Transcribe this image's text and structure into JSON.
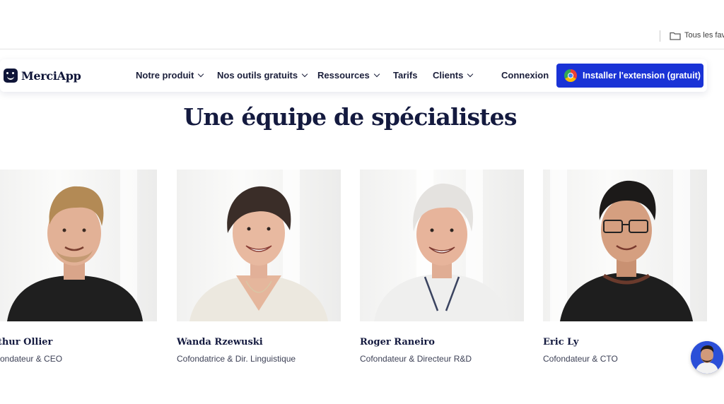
{
  "browser": {
    "bookmarks_label": "Tous les favo"
  },
  "nav": {
    "logo": "MerciApp",
    "items": [
      {
        "label": "Notre produit",
        "dropdown": true
      },
      {
        "label": "Nos outils gratuits",
        "dropdown": true
      },
      {
        "label": "Ressources",
        "dropdown": true
      },
      {
        "label": "Tarifs",
        "dropdown": false
      },
      {
        "label": "Clients",
        "dropdown": true
      }
    ],
    "login": "Connexion",
    "cta": "Installer l'extension (gratuit)",
    "cta_color": "#1a33d6"
  },
  "section": {
    "title": "Une équipe de spécialistes"
  },
  "team": [
    {
      "name": "rthur Ollier",
      "role": "ofondateur & CEO"
    },
    {
      "name": "Wanda Rzewuski",
      "role": "Cofondatrice & Dir. Linguistique"
    },
    {
      "name": "Roger Raneiro",
      "role": "Cofondateur & Directeur R&D"
    },
    {
      "name": "Eric Ly",
      "role": "Cofondateur & CTO"
    }
  ],
  "chat": {
    "icon": "chat-avatar-icon"
  }
}
